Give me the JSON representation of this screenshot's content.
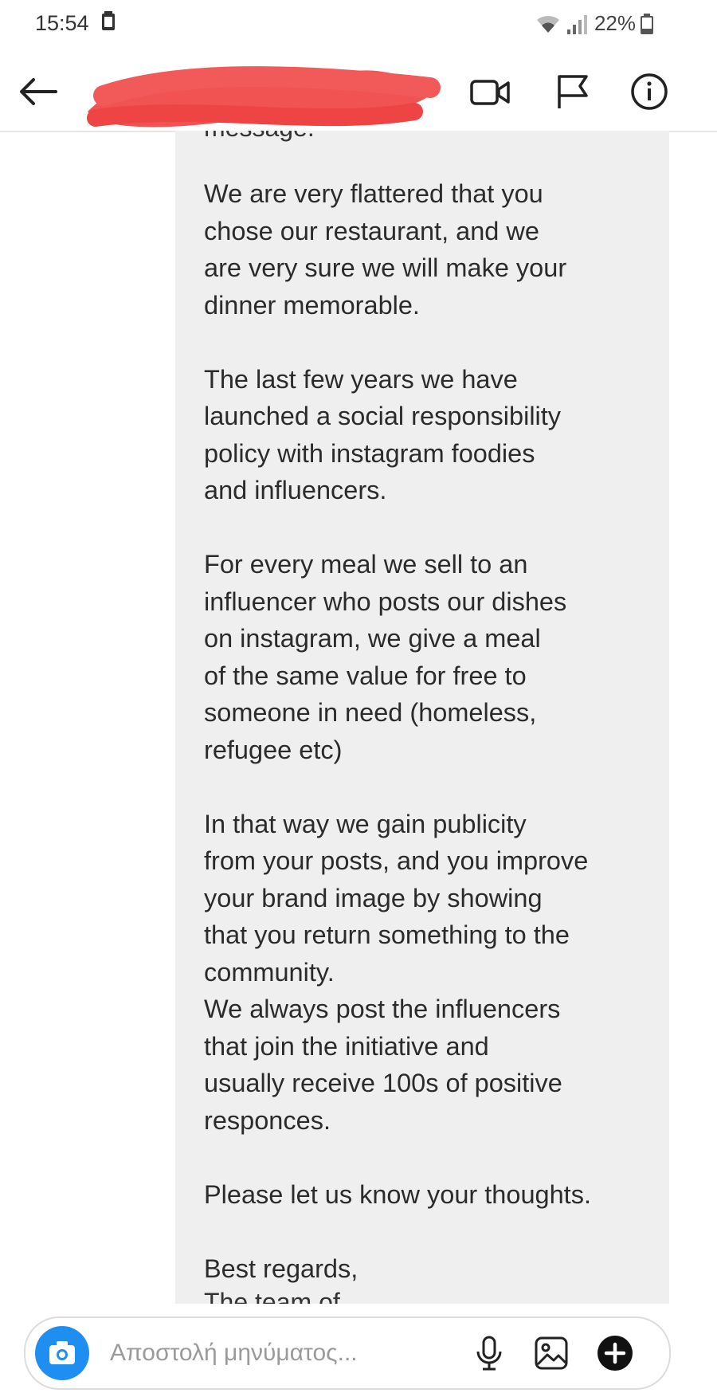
{
  "status_bar": {
    "time": "15:54",
    "battery": "22%"
  },
  "header": {
    "contact_name_visible": "NA",
    "icons": [
      "back-arrow-icon",
      "video-call-icon",
      "flag-icon",
      "info-icon"
    ]
  },
  "message": {
    "partial_top": "message.",
    "body": "We are very flattered that you\nchose our restaurant, and we\nare very sure we will make your\ndinner memorable.\n\nThe last few years we have\nlaunched a social responsibility\npolicy with instagram foodies\nand influencers.\n\nFor every meal we sell to an\ninfluencer who posts our dishes\non instagram, we give a meal\nof the same value for free to\nsomeone in need (homeless,\nrefugee etc)\n\nIn that way we gain publicity\nfrom your posts, and you improve\nyour brand image by showing\nthat you return something to the\ncommunity.\nWe always post the influencers\nthat join the initiative and\nusually receive 100s of positive\nresponces.\n\nPlease let us know your thoughts.\n\nBest regards,",
    "partial_bottom": "The team of ..."
  },
  "composer": {
    "placeholder": "Αποστολή μηνύματος...",
    "icons": [
      "camera-icon",
      "microphone-icon",
      "gallery-icon",
      "add-icon"
    ]
  },
  "colors": {
    "bubble_bg": "#efefef",
    "camera_blue": "#1e8ef0",
    "redaction_red": "#f04a4a"
  }
}
